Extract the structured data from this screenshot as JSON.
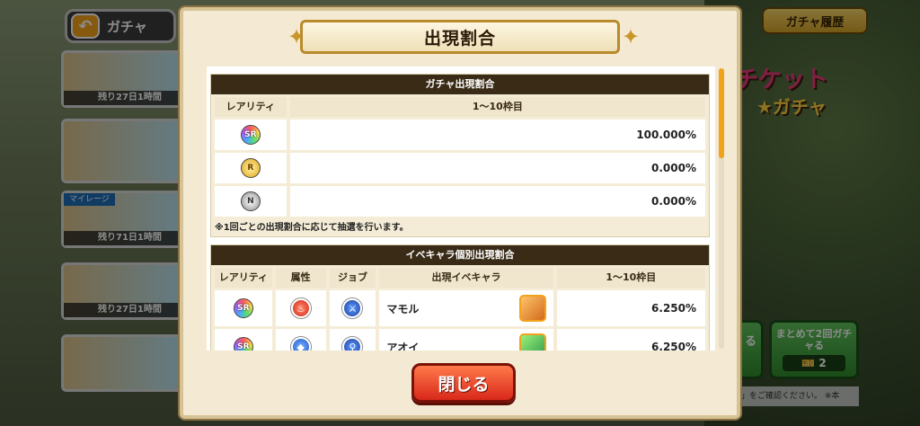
{
  "background": {
    "back_label": "ガチャ",
    "history_label": "ガチャ履歴",
    "banners": [
      {
        "caption": "残り27日1時間",
        "tag": ""
      },
      {
        "caption": "",
        "tag": ""
      },
      {
        "caption": "残り71日1時間",
        "tag": "マイレージ"
      },
      {
        "caption": "残り27日1時間",
        "tag": ""
      },
      {
        "caption": "",
        "tag": ""
      }
    ],
    "ticket_logo_line1": "チケット",
    "ticket_logo_line2": "★ガチャ",
    "single_btn_label": "る",
    "multi_btn_label": "まとめて2回ガチャる",
    "multi_btn_count": "2",
    "note_text": "認」をご確認ください。 ※本"
  },
  "modal": {
    "title": "出現割合",
    "section1": {
      "title": "ガチャ出現割合",
      "headers": [
        "レアリティ",
        "1～10枠目"
      ],
      "rows": [
        {
          "rarity": "SR",
          "value": "100.000%"
        },
        {
          "rarity": "R",
          "value": "0.000%"
        },
        {
          "rarity": "N",
          "value": "0.000%"
        }
      ],
      "note": "※1回ごとの出現割合に応じて抽選を行います。"
    },
    "section2": {
      "title": "イベキャラ個別出現割合",
      "headers": [
        "レアリティ",
        "属性",
        "ジョブ",
        "出現イベキャラ",
        "1～10枠目"
      ],
      "rows": [
        {
          "rarity": "SR",
          "attribute": "fire",
          "job": "sword",
          "name": "マモル",
          "value": "6.250%"
        },
        {
          "rarity": "SR",
          "attribute": "water",
          "job": "staff",
          "name": "アオイ",
          "value": "6.250%"
        }
      ]
    },
    "close_label": "閉じる"
  },
  "colors": {
    "modal_bg": "#f4ead3",
    "section_head": "#3a2b17",
    "close_button": "#d8281a",
    "scroll_thumb": "#f0a21b"
  },
  "icons": {
    "rarity_sr": "rainbow-star-badge",
    "rarity_r": "gold-badge",
    "rarity_n": "silver-badge",
    "attr_fire": "fire-attribute-icon",
    "attr_water": "water-attribute-icon",
    "job_sword": "sword-job-icon",
    "job_staff": "staff-job-icon"
  }
}
